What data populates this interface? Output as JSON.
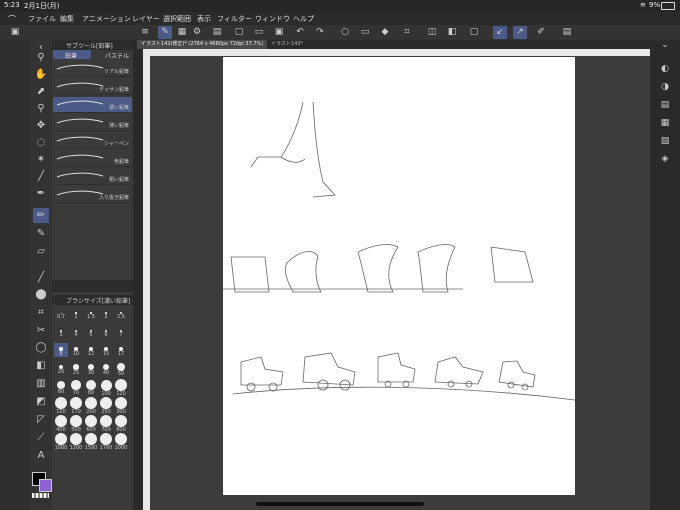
{
  "status": {
    "time": "5:23",
    "date": "2月1日(月)",
    "battery": "9%"
  },
  "menu": [
    "ファイル",
    "編集",
    "アニメーション",
    "レイヤー",
    "選択範囲",
    "表示",
    "フィルター",
    "ウィンドウ",
    "ヘルプ"
  ],
  "tabs": [
    {
      "label": "イラスト142(修正)* (2764 x 4680px 72dpi 37.7%)"
    },
    {
      "label": "イラスト143*"
    }
  ],
  "subtool": {
    "header": "サブツール[鉛筆]",
    "groups": [
      "鉛筆",
      "パステル"
    ],
    "brushes": [
      "リアル鉛筆",
      "デッサン鉛筆",
      "濃い鉛筆",
      "薄い鉛筆",
      "シャーペン",
      "色鉛筆",
      "粗い鉛筆",
      "入り抜き鉛筆"
    ],
    "selected_index": 2
  },
  "brush_size": {
    "header": "ブラシサイズ[濃い鉛筆]",
    "sizes": [
      "0.7",
      "1",
      "1.5",
      "2",
      "2.5",
      "3",
      "4",
      "5",
      "6",
      "7",
      "8",
      "10",
      "12",
      "15",
      "17",
      "20",
      "25",
      "30",
      "40",
      "50",
      "60",
      "70",
      "80",
      "100",
      "120",
      "150",
      "170",
      "200",
      "250",
      "300",
      "400",
      "500",
      "600",
      "700",
      "800",
      "1000",
      "1200",
      "1500",
      "1700",
      "2000"
    ],
    "selected": "8"
  },
  "colors": {
    "main": "#000000",
    "sub": "#8e63d6",
    "accent": "#4c5a87"
  }
}
